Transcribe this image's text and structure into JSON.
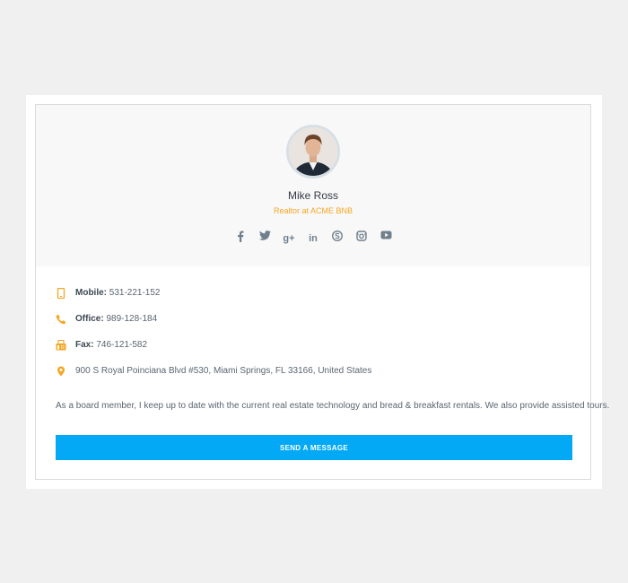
{
  "profile": {
    "name": "Mike Ross",
    "role": "Realtor at ACME BNB",
    "avatar": "avatar-photo"
  },
  "socials": [
    {
      "icon": "facebook-icon"
    },
    {
      "icon": "twitter-icon"
    },
    {
      "icon": "google-plus-icon",
      "text": "g+"
    },
    {
      "icon": "linkedin-icon",
      "text": "in"
    },
    {
      "icon": "skype-icon"
    },
    {
      "icon": "instagram-icon"
    },
    {
      "icon": "youtube-icon"
    }
  ],
  "contact": {
    "mobile": {
      "label": "Mobile:",
      "value": "531-221-152",
      "icon": "mobile-phone-icon"
    },
    "office": {
      "label": "Office:",
      "value": "989-128-184",
      "icon": "phone-icon"
    },
    "fax": {
      "label": "Fax:",
      "value": "746-121-582",
      "icon": "fax-icon"
    },
    "address": {
      "value": "900 S Royal Poinciana Blvd #530, Miami Springs, FL 33166, United States",
      "icon": "map-pin-icon"
    }
  },
  "bio": "As a board member, I keep up to date with the current real estate technology and bread & breakfast rentals. We also provide assisted tours.",
  "cta": {
    "label": "SEND A MESSAGE"
  },
  "colors": {
    "accent": "#f5a623",
    "button": "#03a9f4",
    "icon_gray": "#6f808c"
  }
}
